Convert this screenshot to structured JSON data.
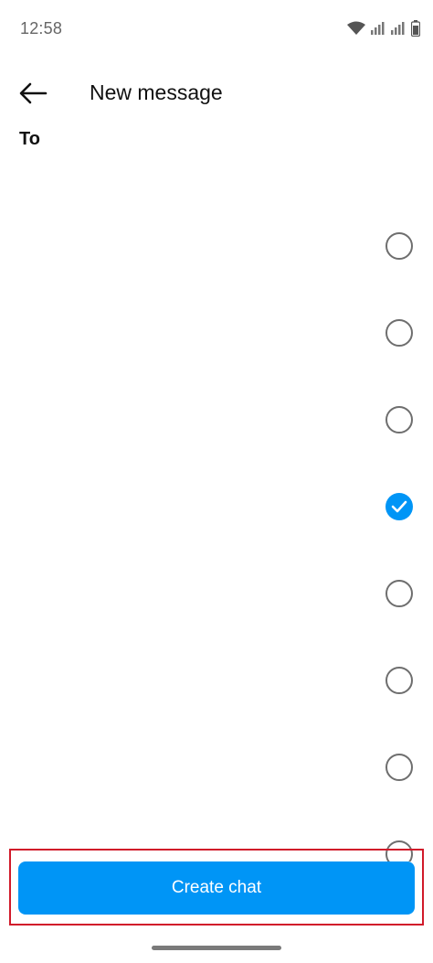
{
  "status_bar": {
    "time": "12:58",
    "icons": [
      "wifi-icon",
      "signal-icon",
      "signal-icon",
      "battery-icon"
    ]
  },
  "header": {
    "back_icon": "arrow-left-icon",
    "title": "New message"
  },
  "to": {
    "label": "To",
    "value": "",
    "placeholder": ""
  },
  "contacts": [
    {
      "name": "",
      "selected": false
    },
    {
      "name": "",
      "selected": false
    },
    {
      "name": "",
      "selected": false
    },
    {
      "name": "",
      "selected": true
    },
    {
      "name": "",
      "selected": false
    },
    {
      "name": "",
      "selected": false
    },
    {
      "name": "",
      "selected": false
    },
    {
      "name": "",
      "selected": false
    }
  ],
  "actions": {
    "create_chat_label": "Create chat"
  },
  "colors": {
    "accent": "#0095f6",
    "radio_border": "#6e6e6e",
    "highlight_border": "#d11a2a"
  }
}
